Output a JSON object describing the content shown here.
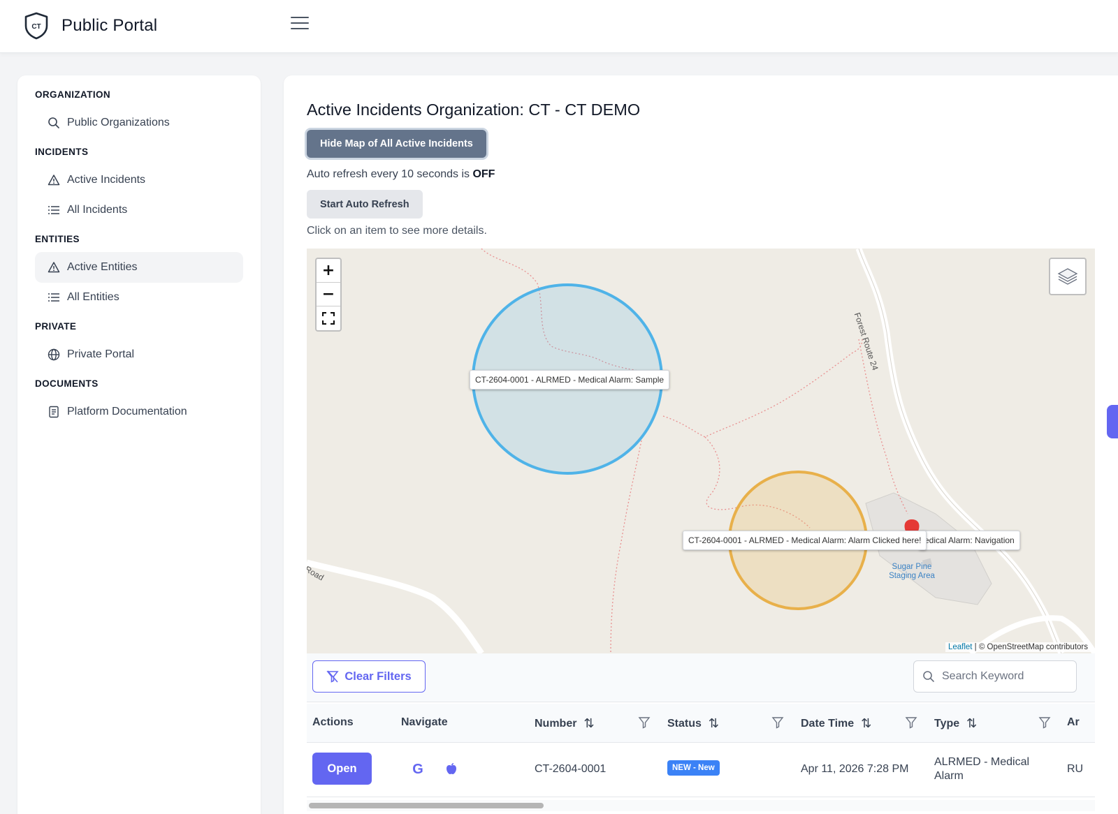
{
  "header": {
    "logo_text": "CT",
    "title": "Public Portal"
  },
  "sidebar": {
    "sections": [
      {
        "label": "ORGANIZATION",
        "items": [
          {
            "label": "Public Organizations",
            "icon": "search-icon"
          }
        ]
      },
      {
        "label": "INCIDENTS",
        "items": [
          {
            "label": "Active Incidents",
            "icon": "warning-icon"
          },
          {
            "label": "All Incidents",
            "icon": "list-icon"
          }
        ]
      },
      {
        "label": "ENTITIES",
        "items": [
          {
            "label": "Active Entities",
            "icon": "warning-icon",
            "active": true
          },
          {
            "label": "All Entities",
            "icon": "list-icon"
          }
        ]
      },
      {
        "label": "PRIVATE",
        "items": [
          {
            "label": "Private Portal",
            "icon": "globe-icon"
          }
        ]
      },
      {
        "label": "DOCUMENTS",
        "items": [
          {
            "label": "Platform Documentation",
            "icon": "document-icon"
          }
        ]
      }
    ]
  },
  "main": {
    "title": "Active Incidents Organization: CT - CT DEMO",
    "hide_map_button": "Hide Map of All Active Incidents",
    "refresh_prefix": "Auto refresh every 10 seconds is ",
    "refresh_state": "OFF",
    "auto_refresh_button": "Start Auto Refresh",
    "hint": "Click on an item to see more details."
  },
  "map": {
    "zoom_in": "+",
    "zoom_out": "−",
    "tooltips": [
      "CT-2604-0001 - ALRMED - Medical Alarm: Sample",
      "CT-2604-0001 - ALRMED - Medical Alarm: Alarm Clicked here!",
      "edical Alarm: Navigation"
    ],
    "road_labels": [
      "Forest Route 24",
      "Road"
    ],
    "place_label": "Sugar Pine Staging Area",
    "attribution_leaflet": "Leaflet",
    "attribution_rest": " | © OpenStreetMap contributors",
    "colors": {
      "circle_blue": "#4fb3e8",
      "circle_orange": "#e8b04a",
      "marker": "#e53935"
    }
  },
  "toolbar": {
    "clear_filters": "Clear Filters",
    "search_placeholder": "Search Keyword"
  },
  "table": {
    "headers": {
      "actions": "Actions",
      "navigate": "Navigate",
      "number": "Number",
      "status": "Status",
      "datetime": "Date Time",
      "type": "Type",
      "area": "Ar"
    },
    "sort_glyph": "⇅",
    "rows": [
      {
        "open": "Open",
        "number": "CT-2604-0001",
        "status": "NEW - New",
        "datetime": "Apr 11, 2026 7:28 PM",
        "type_line1": "ALRMED - Medical",
        "type_line2": "Alarm",
        "area": "RU"
      }
    ]
  },
  "theme": {
    "accent": "#6366f1",
    "status_badge": "#3b82f6",
    "secondary_button": "#64748b"
  }
}
